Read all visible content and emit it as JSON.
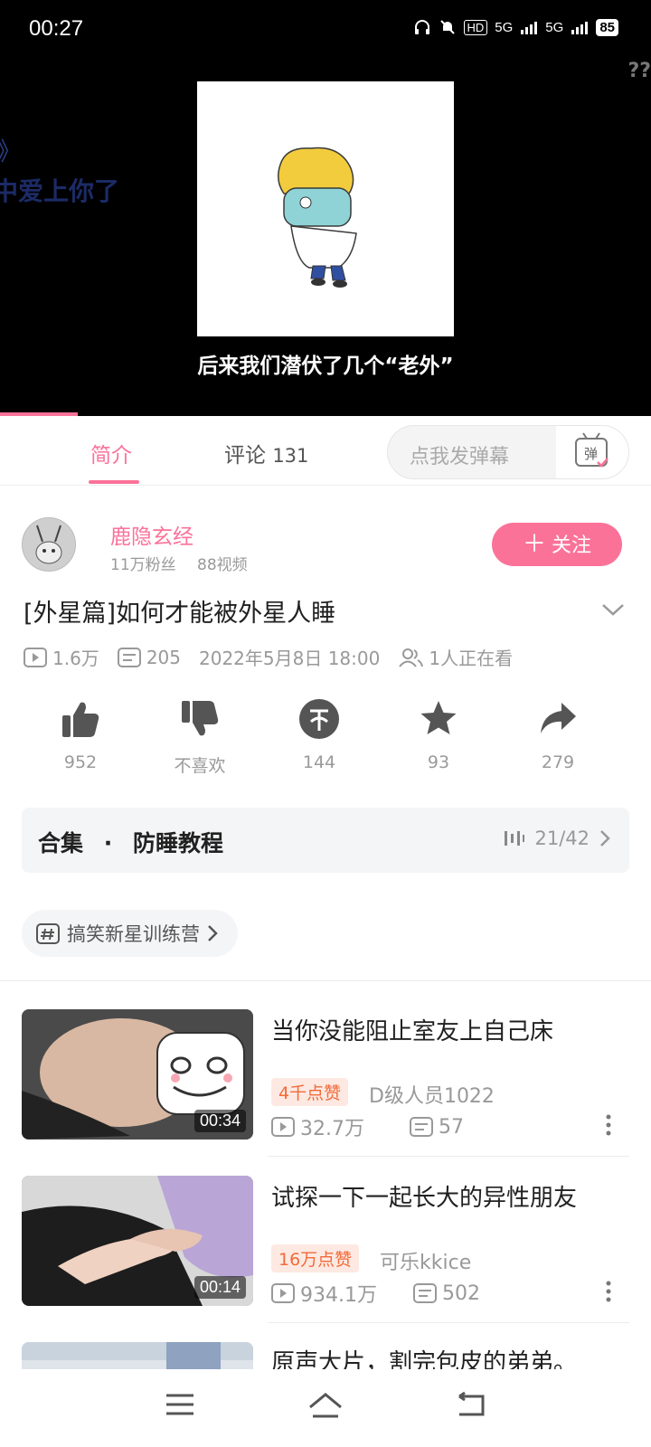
{
  "status_bar": {
    "time": "00:27",
    "network1": "5G",
    "network2": "5G",
    "battery": "85"
  },
  "player": {
    "subtitle": "后来我们潜伏了几个“老外”",
    "danmaku": [
      "中爱上你了",
      "》"
    ],
    "danmaku_right": "??",
    "progress_fraction": 0.12
  },
  "tabs": [
    {
      "label": "简介"
    },
    {
      "label": "评论",
      "count": "131"
    }
  ],
  "danmaku_input": {
    "placeholder": "点我发弹幕",
    "button": "弹"
  },
  "uploader": {
    "name": "鹿隐玄经",
    "followers": "11万粉丝",
    "videos": "88视频",
    "follow_label": "关注"
  },
  "video": {
    "title": "[外星篇]如何才能被外星人睡",
    "views": "1.6万",
    "danmaku_count": "205",
    "date": "2022年5月8日 18:00",
    "watching": "1人正在看"
  },
  "actions": [
    {
      "icon": "thumbs-up-icon",
      "label": "952"
    },
    {
      "icon": "thumbs-down-icon",
      "label": "不喜欢"
    },
    {
      "icon": "coin-icon",
      "label": "144"
    },
    {
      "icon": "star-icon",
      "label": "93"
    },
    {
      "icon": "share-icon",
      "label": "279"
    }
  ],
  "collection": {
    "label": "合集",
    "dot": "·",
    "name": "防睡教程",
    "progress": "21/42"
  },
  "tag": {
    "label": "搞笑新星训练营"
  },
  "recommendations": [
    {
      "title": "当你没能阻止室友上自己床",
      "duration": "00:34",
      "likes": "4千点赞",
      "author": "D级人员1022",
      "views": "32.7万",
      "danmaku": "57"
    },
    {
      "title": "试探一下一起长大的异性朋友",
      "duration": "00:14",
      "likes": "16万点赞",
      "author": "可乐kkice",
      "views": "934.1万",
      "danmaku": "502"
    },
    {
      "title": "原声大片，割完包皮的弟弟。"
    }
  ],
  "colors": {
    "accent": "#fb7299",
    "likes_badge_bg": "#fde9e2",
    "likes_badge_text": "#f26a3a"
  }
}
